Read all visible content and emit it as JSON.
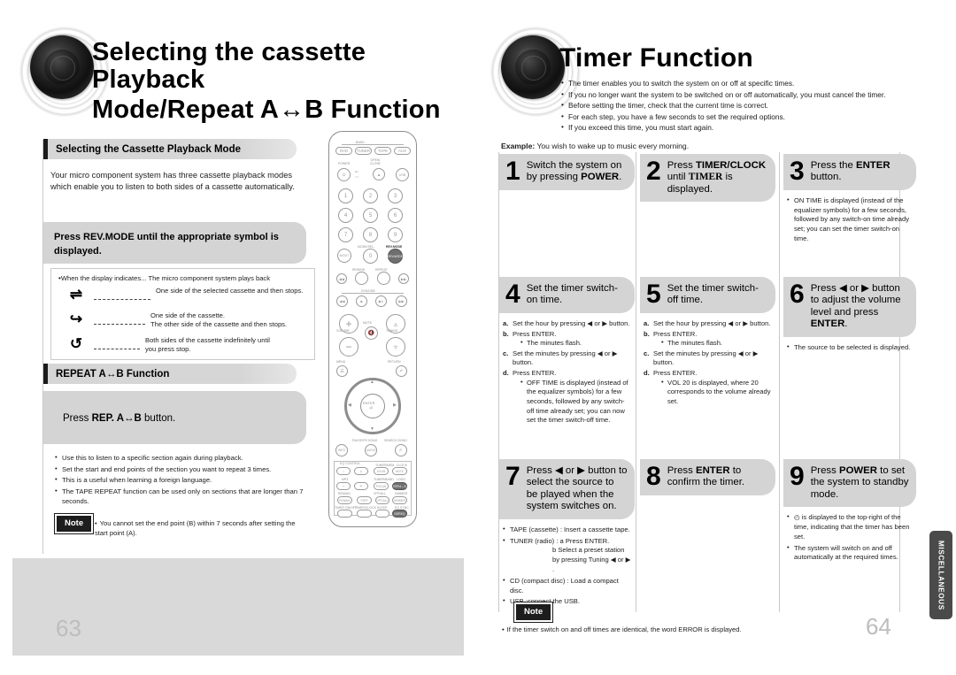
{
  "left_page": {
    "title_line1": "Selecting the cassette Playback",
    "title_line2": "Mode/Repeat A↔B Function",
    "page_number": "63",
    "section1": {
      "bar_label": "Selecting the Cassette Playback Mode",
      "intro": "Your micro component system has three cassette playback modes which enable you to listen to both sides of a cassette automatically.",
      "instruction": "Press REV.MODE until the appropriate symbol is displayed.",
      "table_header": "When the display indicates... The micro component system plays back",
      "rows": [
        {
          "symbol": "⇌",
          "text": "One side of the selected cassette and then stops."
        },
        {
          "symbol": "↪",
          "text": "One side of the cassette.\nThe other side of the cassette and then stops."
        },
        {
          "symbol": "↺",
          "text": "Both sides of the cassette indefinitely until\nyou press stop."
        }
      ]
    },
    "section2": {
      "bar_label": "REPEAT A↔B Function",
      "instruction_pre": "Press ",
      "instruction_bold": "REP. A↔B",
      "instruction_post": " button.",
      "bullets": [
        "Use this to listen to a specific section again during playback.",
        "Set the start and end points of the section you want to repeat 3 times.",
        "This is a useful when learning a foreign language.",
        "The TAPE REPEAT function can be used only on sections that are longer than 7 seconds."
      ],
      "note_label": "Note",
      "note_text": "You cannot set the end point (B) within 7 seconds after setting the start point (A)."
    },
    "remote": {
      "band_label": "BAND",
      "source_buttons": [
        "DVD",
        "TUNER",
        "TAPE",
        "AUX"
      ],
      "power_label": "POWER",
      "open_close_label": "OPEN/\nCLOSE",
      "usb_label": "USB",
      "numeric_keys": [
        "1",
        "2",
        "3",
        "4",
        "5",
        "6",
        "7",
        "8",
        "9",
        "0"
      ],
      "mode_sel_label": "MODE/SEL.",
      "rev_mode_label": "REV.MODE",
      "mo_st_label": "MO/ST",
      "rewind_label": "REWIND",
      "repeat_label": "REPEAT",
      "dvd_usb_label": "DVD/USB",
      "volume_label": "VOLUME",
      "mute_label": "MUTE",
      "tuning_label": "TUNING",
      "menu_label": "MENU",
      "return_label": "RETURN",
      "enter_label": "ENTER",
      "favorite_song_label": "FAVORITE SONG",
      "search_song_label": "SEARCH SONG",
      "info_label": "INFO",
      "audio_label": "AUDIO",
      "eq_control_label": "EQ CONTROL",
      "mp3_label": "MP3",
      "tuner_mem_label": "TUNER/MEM.",
      "tuner_band_label": "TUNER/BAND",
      "clock_label": "CLOCK",
      "logo_label": "LOGO",
      "zoom_label": "ZOOM",
      "pscan_label": "P.SCAN",
      "note_label": "NOTE",
      "remain_label": "REMAIN",
      "step_label": "STEP",
      "vfp_all_label": "VFP/ALL",
      "dimmer_label": "DIMMER",
      "timer_onoff_label": "TIMER ON/OFF",
      "timer_clock_label": "TIMER/CLOCK",
      "sleep_label": "SLEEP",
      "eq_sync_label": "EQ SYNC",
      "dsp_eq_label": "DSP/EQ",
      "repeat_ab_label": "REP.A↔B"
    }
  },
  "right_page": {
    "title": "Timer Function",
    "page_number": "64",
    "head_bullets": [
      "The timer enables you to switch the system on or off at specific times.",
      "If you no longer want the system to be switched on or off automatically, you must cancel the timer.",
      "Before setting the timer, check that the current time is correct.",
      "For each step, you have a few seconds to set the required options."
    ],
    "head_bullet_sub": "If you exceed this time, you must start again.",
    "example_label": "Example:",
    "example_text": " You wish to wake up to music every morning.",
    "steps": [
      {
        "number": "1",
        "heading_parts": [
          {
            "t": "Switch the system on by pressing ",
            "b": false
          },
          {
            "t": "POWER",
            "b": true
          },
          {
            "t": ".",
            "b": false
          }
        ],
        "body": []
      },
      {
        "number": "2",
        "heading_parts": [
          {
            "t": "Press ",
            "b": false
          },
          {
            "t": "TIMER/CLOCK",
            "b": true
          },
          {
            "t": " until ",
            "b": false
          },
          {
            "t": "TIMER",
            "b": true
          },
          {
            "t": " is displayed.",
            "b": false
          }
        ],
        "body": []
      },
      {
        "number": "3",
        "heading_parts": [
          {
            "t": "Press the ",
            "b": false
          },
          {
            "t": "ENTER",
            "b": true
          },
          {
            "t": " button.",
            "b": false
          }
        ],
        "body": [
          "ON TIME is displayed (instead of the equalizer symbols) for a few seconds, followed by any switch-on time already set; you can set the timer switch-on time."
        ]
      },
      {
        "number": "4",
        "heading_parts": [
          {
            "t": "Set the timer switch-on time.",
            "b": false
          }
        ],
        "substeps": [
          {
            "mark": "a.",
            "text": "Set the hour by pressing ◀ or ▶ button.",
            "sub": []
          },
          {
            "mark": "b.",
            "text": "Press ENTER.",
            "sub": [
              "The minutes flash."
            ]
          },
          {
            "mark": "c.",
            "text": "Set the minutes by pressing ◀ or ▶ button.",
            "sub": []
          },
          {
            "mark": "d.",
            "text": "Press ENTER.",
            "sub": [
              "OFF TIME is displayed (instead of the equalizer symbols) for a few seconds, followed by any switch-off time already set; you can now set the timer switch-off time."
            ]
          }
        ]
      },
      {
        "number": "5",
        "heading_parts": [
          {
            "t": "Set the timer switch-off time.",
            "b": false
          }
        ],
        "substeps": [
          {
            "mark": "a.",
            "text": "Set the hour by pressing ◀ or ▶ button.",
            "sub": []
          },
          {
            "mark": "b.",
            "text": "Press ENTER.",
            "sub": [
              "The minutes flash."
            ]
          },
          {
            "mark": "c.",
            "text": "Set the minutes by pressing ◀ or ▶ button.",
            "sub": []
          },
          {
            "mark": "d.",
            "text": "Press ENTER.",
            "sub": [
              "VOL 20 is displayed, where 20 corresponds to the volume already set."
            ]
          }
        ]
      },
      {
        "number": "6",
        "heading_parts": [
          {
            "t": "Press ◀ or ▶ button to adjust the volume level and press ",
            "b": false
          },
          {
            "t": "ENTER",
            "b": true
          },
          {
            "t": ".",
            "b": false
          }
        ],
        "body": [
          "The source to be selected is displayed."
        ]
      },
      {
        "number": "7",
        "heading_parts": [
          {
            "t": "Press ◀ or ▶ button to select the source to be played when the system switches on.",
            "b": false
          }
        ],
        "body": []
      },
      {
        "number": "8",
        "heading_parts": [
          {
            "t": "Press ",
            "b": false
          },
          {
            "t": "ENTER",
            "b": true
          },
          {
            "t": " to confirm the timer.",
            "b": false
          }
        ],
        "body": []
      },
      {
        "number": "9",
        "heading_parts": [
          {
            "t": "Press ",
            "b": false
          },
          {
            "t": "POWER",
            "b": true
          },
          {
            "t": " to set the system to standby mode.",
            "b": false
          }
        ],
        "body": [
          "◴ is displayed to the top-right of the time, indicating that the timer has been set.",
          "The system will switch on and off automatically at the required times."
        ]
      }
    ],
    "source_notes": [
      "TAPE (cassette) : Insert a cassette tape.",
      "TUNER (radio) : a Press ENTER."
    ],
    "source_note_tuner_b": "b Select a preset station by pressing Tuning ◀ or ▶ .",
    "source_note_cd": "CD (compact disc) : Load a compact disc.",
    "source_note_usb": "USB :connect the USB.",
    "note_label": "Note",
    "note_text": "If the timer switch on and off times are identical, the word ERROR is displayed.",
    "side_tab": "MISCELLANEOUS"
  }
}
